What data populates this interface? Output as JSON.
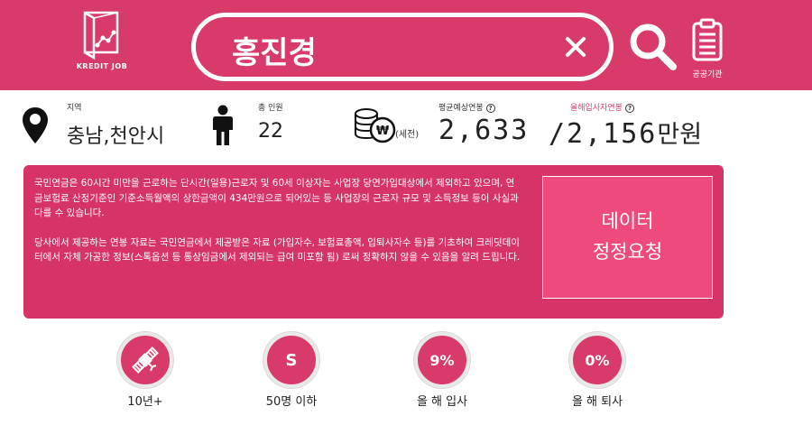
{
  "header": {
    "logo_text": "KREDIT JOB",
    "search_value": "홍진경",
    "agency_label": "공공기관"
  },
  "info": {
    "region": {
      "label": "지역",
      "value": "충남,천안시"
    },
    "staff": {
      "label": "총 인원",
      "value": "22"
    },
    "salary": {
      "avg_label": "평균예상연봉",
      "pretax_note": "(세전)",
      "avg_value": "2,633",
      "new_label": "올해입사자연봉",
      "new_value": "/2,156",
      "unit": "만원",
      "help": "?"
    }
  },
  "notice": {
    "paragraph1": "국민연금은 60시간 미만을 근로하는 단시간(일용)근로자 및 60세 이상자는 사업장 당연가입대상에서 제외하고 있으며, 연금보험료 산정기준인 기준소득월액의 상한금액이 434만원으로 되어있는 등 사업장의 근로자 규모 및 소득정보 등이 사실과 다를 수 있습니다.",
    "paragraph2": "당사에서 제공하는 연봉 자료는 국민연금에서 제공받은 자료 (가입자수, 보험료총액, 입퇴사자수 등)를 기초하여 크레딧데이터에서 자체 가공한 정보(스톡옵션 등 통상임금에서 제외되는 급여 미포함 됨) 로써 정확하지 않을 수 있음을 알려 드립니다.",
    "correction_line1": "데이터",
    "correction_line2": "정정요청"
  },
  "badges": [
    {
      "icon": "satellite-icon",
      "text": "",
      "label": "10년+"
    },
    {
      "icon": "",
      "text": "S",
      "label": "50명 이하"
    },
    {
      "icon": "",
      "text": "9%",
      "label": "올 해 입사"
    },
    {
      "icon": "",
      "text": "0%",
      "label": "올 해 퇴사"
    }
  ],
  "colors": {
    "brand": "#d83a6a",
    "notice_bg": "#d63466",
    "button_bg": "#ee4b7c"
  }
}
